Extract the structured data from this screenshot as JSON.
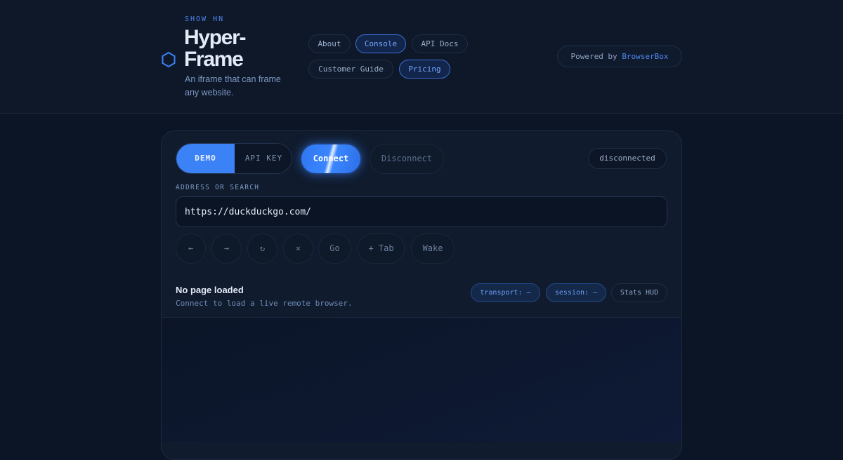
{
  "header": {
    "eyebrow": "SHOW HN",
    "title": "Hyper-Frame",
    "tagline": "An iframe that can frame any website.",
    "logo_icon": "hexagon-icon",
    "nav": [
      {
        "label": "About",
        "active": false
      },
      {
        "label": "Console",
        "active": true
      },
      {
        "label": "API Docs",
        "active": false
      },
      {
        "label": "Customer Guide",
        "active": false
      },
      {
        "label": "Pricing",
        "active": true
      }
    ],
    "powered_prefix": "Powered by",
    "powered_brand": "BrowserBox"
  },
  "console": {
    "mode_demo": "DEMO",
    "mode_api_key": "API KEY",
    "selected_mode": "DEMO",
    "connect_label": "Connect",
    "disconnect_label": "Disconnect",
    "status": "disconnected",
    "address_label": "ADDRESS OR SEARCH",
    "address_value": "https://duckduckgo.com/",
    "tools": {
      "back": "←",
      "forward": "→",
      "reload": "↻",
      "stop": "✕",
      "go": "Go",
      "new_tab": "+ Tab",
      "wake": "Wake"
    },
    "page_title": "No page loaded",
    "page_subtitle": "Connect to load a live remote browser.",
    "transport": "transport: —",
    "session": "session: —",
    "stats_hud": "Stats HUD"
  },
  "colors": {
    "accent": "#3b82f6",
    "background": "#0c1526",
    "brand_link": "#4f8af5"
  }
}
